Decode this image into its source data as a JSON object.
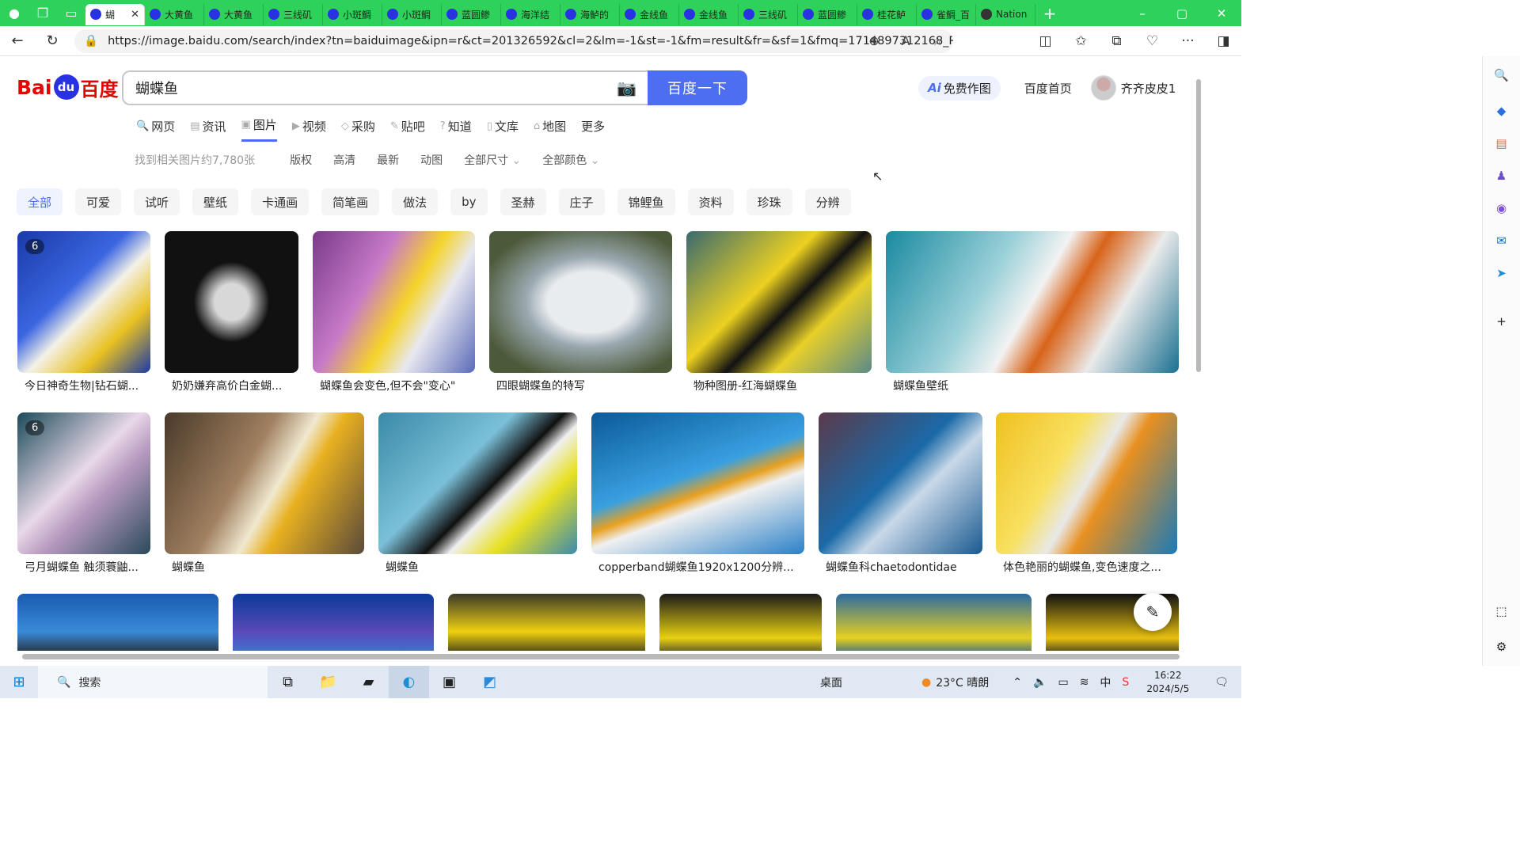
{
  "browser": {
    "tabs": [
      {
        "label": "蝴",
        "active": true
      },
      {
        "label": "大黄鱼"
      },
      {
        "label": "大黄鱼"
      },
      {
        "label": "三线矶"
      },
      {
        "label": "小斑鲷"
      },
      {
        "label": "小斑鲷"
      },
      {
        "label": "蓝圆鲹"
      },
      {
        "label": "海洋结"
      },
      {
        "label": "海鲈的"
      },
      {
        "label": "金线鱼"
      },
      {
        "label": "金线鱼"
      },
      {
        "label": "三线矶"
      },
      {
        "label": "蓝圆鲹"
      },
      {
        "label": "桂花鲈"
      },
      {
        "label": "雀鲷_百"
      },
      {
        "label": "Nation"
      }
    ],
    "url": "https://image.baidu.com/search/index?tn=baiduimage&ipn=r&ct=201326592&cl=2&lm=-1&st=-1&fm=result&fr=&sf=1&fmq=1714897312168_R&pv=&ic=..."
  },
  "header": {
    "logo_latin": "Bai",
    "logo_du": "du",
    "logo_cn": "百度",
    "query": "蝴蝶鱼",
    "search_button": "百度一下",
    "ai_label": "Ai",
    "ai_text": "免费作图",
    "home_link": "百度首页",
    "username": "齐齐皮皮1"
  },
  "nav": [
    "网页",
    "资讯",
    "图片",
    "视频",
    "采购",
    "贴吧",
    "知道",
    "文库",
    "地图",
    "更多"
  ],
  "filters": {
    "count_text": "找到相关图片约7,780张",
    "items": [
      "版权",
      "高清",
      "最新",
      "动图",
      "全部尺寸",
      "全部颜色"
    ]
  },
  "chips": [
    "全部",
    "可爱",
    "试听",
    "壁纸",
    "卡通画",
    "简笔画",
    "做法",
    "by",
    "圣赫",
    "庄子",
    "锦鲤鱼",
    "资料",
    "珍珠",
    "分辨"
  ],
  "results_row1": [
    {
      "caption": "今日神奇生物|钻石蝴...",
      "badge": "6"
    },
    {
      "caption": "奶奶嫌弃高价白金蝴..."
    },
    {
      "caption": "蝴蝶鱼会变色,但不会\"变心\""
    },
    {
      "caption": "四眼蝴蝶鱼的特写"
    },
    {
      "caption": "物种图册-红海蝴蝶鱼"
    },
    {
      "caption": "蝴蝶鱼壁纸"
    }
  ],
  "results_row2": [
    {
      "caption": "弓月蝴蝶鱼 触须蓑鼬...",
      "badge": "6"
    },
    {
      "caption": "蝴蝶鱼"
    },
    {
      "caption": "蝴蝶鱼"
    },
    {
      "caption": "copperband蝴蝶鱼1920x1200分辨..."
    },
    {
      "caption": "蝴蝶鱼科chaetodontidae"
    },
    {
      "caption": "体色艳丽的蝴蝶鱼,变色速度之..."
    }
  ],
  "taskbar": {
    "search_text": "搜索",
    "desktop_label": "桌面",
    "weather": "23°C  晴朗",
    "ime": "中",
    "time": "16:22",
    "date": "2024/5/5"
  }
}
